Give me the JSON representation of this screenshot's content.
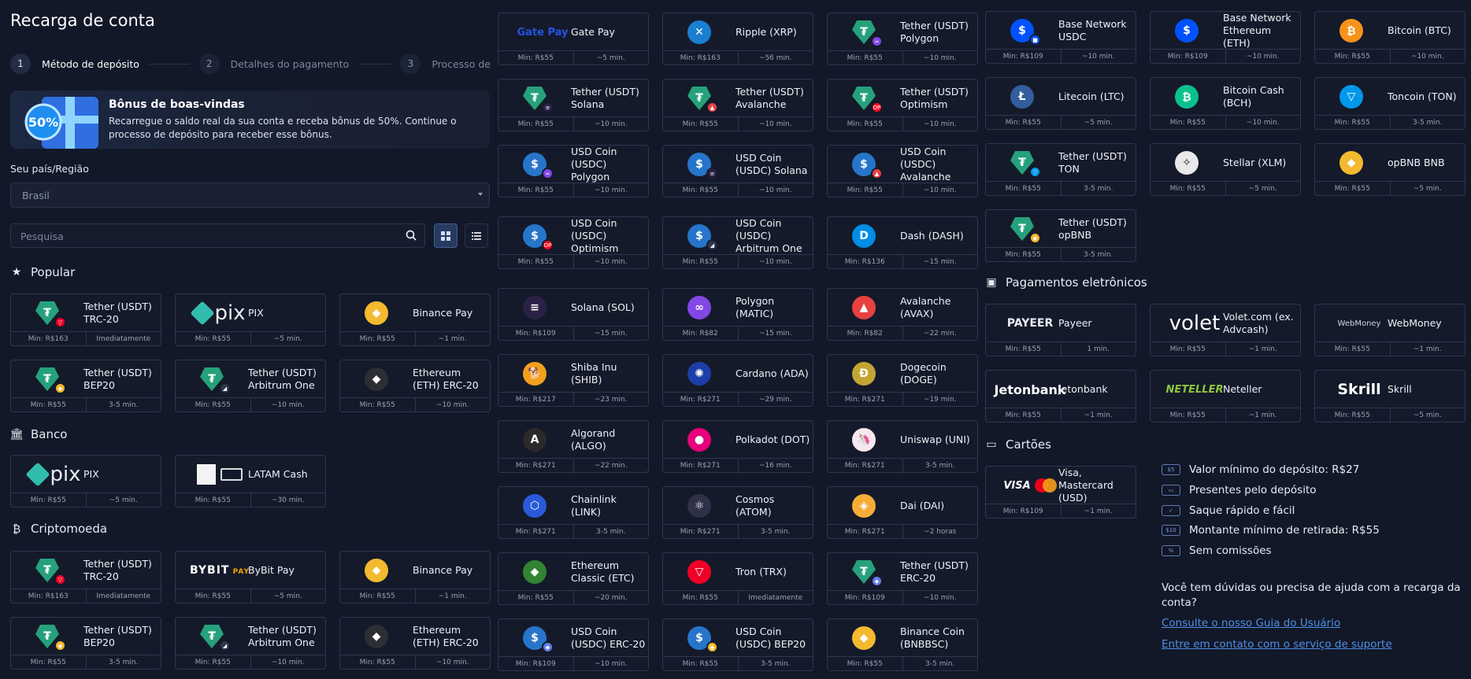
{
  "page": {
    "title": "Recarga de conta",
    "steps": [
      {
        "num": "1",
        "label": "Método de depósito"
      },
      {
        "num": "2",
        "label": "Detalhes do pagamento"
      },
      {
        "num": "3",
        "label": "Processo de"
      }
    ],
    "bonus": {
      "badge": "50%",
      "title": "Bônus de boas-vindas",
      "text": "Recarregue o saldo real da sua conta e receba bônus de 50%. Continue o processo de depósito para receber esse bônus."
    },
    "country_label": "Seu país/Região",
    "country_value": "Brasil",
    "search_placeholder": "Pesquisa",
    "sections": {
      "popular": "Popular",
      "bank": "Banco",
      "crypto": "Criptomoeda",
      "epay": "Pagamentos eletrônicos",
      "cards": "Cartões"
    }
  },
  "methods": {
    "popular": [
      {
        "name": "Tether (USDT) TRC-20",
        "min": "Min: R$163",
        "time": "Imediatamente",
        "icon": "tether-trc20-icon"
      },
      {
        "name": "PIX",
        "min": "Min: R$55",
        "time": "~5 min.",
        "icon": "pix-logo-icon",
        "logo_text": "pix"
      },
      {
        "name": "Binance Pay",
        "min": "Min: R$55",
        "time": "~1 min.",
        "icon": "binance-icon"
      },
      {
        "name": "Tether (USDT) BEP20",
        "min": "Min: R$55",
        "time": "3-5 min.",
        "icon": "tether-bep20-icon"
      },
      {
        "name": "Tether (USDT) Arbitrum One",
        "min": "Min: R$55",
        "time": "~10 min.",
        "icon": "tether-arbitrum-icon"
      },
      {
        "name": "Ethereum (ETH) ERC-20",
        "min": "Min: R$55",
        "time": "~10 min.",
        "icon": "ethereum-icon"
      }
    ],
    "bank": [
      {
        "name": "PIX",
        "min": "Min: R$55",
        "time": "~5 min.",
        "icon": "pix-logo-icon",
        "logo_text": "pix"
      },
      {
        "name": "LATAM Cash",
        "min": "Min: R$55",
        "time": "~30 min.",
        "icon": "latam-cash-icon"
      }
    ],
    "crypto_left": [
      {
        "name": "Tether (USDT) TRC-20",
        "min": "Min: R$163",
        "time": "Imediatamente",
        "icon": "tether-trc20-icon"
      },
      {
        "name": "ByBit Pay",
        "min": "Min: R$55",
        "time": "~5 min.",
        "icon": "bybit-logo-icon",
        "logo_text": "BYBIT"
      },
      {
        "name": "Binance Pay",
        "min": "Min: R$55",
        "time": "~1 min.",
        "icon": "binance-icon"
      },
      {
        "name": "Tether (USDT) BEP20",
        "min": "Min: R$55",
        "time": "3-5 min.",
        "icon": "tether-bep20-icon"
      },
      {
        "name": "Tether (USDT) Arbitrum One",
        "min": "Min: R$55",
        "time": "~10 min.",
        "icon": "tether-arbitrum-icon"
      },
      {
        "name": "Ethereum (ETH) ERC-20",
        "min": "Min: R$55",
        "time": "~10 min.",
        "icon": "ethereum-icon"
      }
    ],
    "crypto_mid": [
      {
        "name": "Gate Pay",
        "min": "Min: R$55",
        "time": "~5 min.",
        "icon": "gate-pay-logo-icon",
        "logo_text": "Gate Pay"
      },
      {
        "name": "Ripple (XRP)",
        "min": "Min: R$163",
        "time": "~56 min.",
        "icon": "xrp-icon"
      },
      {
        "name": "Tether (USDT) Polygon",
        "min": "Min: R$55",
        "time": "~10 min.",
        "icon": "tether-polygon-icon"
      },
      {
        "name": "Tether (USDT) Solana",
        "min": "Min: R$55",
        "time": "~10 min.",
        "icon": "tether-solana-icon"
      },
      {
        "name": "Tether (USDT) Avalanche",
        "min": "Min: R$55",
        "time": "~10 min.",
        "icon": "tether-avalanche-icon"
      },
      {
        "name": "Tether (USDT) Optimism",
        "min": "Min: R$55",
        "time": "~10 min.",
        "icon": "tether-optimism-icon"
      },
      {
        "name": "USD Coin (USDC) Polygon",
        "min": "Min: R$55",
        "time": "~10 min.",
        "icon": "usdc-polygon-icon"
      },
      {
        "name": "USD Coin (USDC) Solana",
        "min": "Min: R$55",
        "time": "~10 min.",
        "icon": "usdc-solana-icon"
      },
      {
        "name": "USD Coin (USDC) Avalanche",
        "min": "Min: R$55",
        "time": "~10 min.",
        "icon": "usdc-avalanche-icon"
      },
      {
        "name": "USD Coin (USDC) Optimism",
        "min": "Min: R$55",
        "time": "~10 min.",
        "icon": "usdc-optimism-icon"
      },
      {
        "name": "USD Coin (USDC) Arbitrum One",
        "min": "Min: R$55",
        "time": "~10 min.",
        "icon": "usdc-arbitrum-icon"
      },
      {
        "name": "Dash (DASH)",
        "min": "Min: R$136",
        "time": "~15 min.",
        "icon": "dash-icon"
      },
      {
        "name": "Solana (SOL)",
        "min": "Min: R$109",
        "time": "~15 min.",
        "icon": "solana-icon"
      },
      {
        "name": "Polygon (MATIC)",
        "min": "Min: R$82",
        "time": "~15 min.",
        "icon": "polygon-icon"
      },
      {
        "name": "Avalanche (AVAX)",
        "min": "Min: R$82",
        "time": "~22 min.",
        "icon": "avalanche-icon"
      },
      {
        "name": "Shiba Inu (SHIB)",
        "min": "Min: R$217",
        "time": "~23 min.",
        "icon": "shiba-icon"
      },
      {
        "name": "Cardano (ADA)",
        "min": "Min: R$271",
        "time": "~29 min.",
        "icon": "cardano-icon"
      },
      {
        "name": "Dogecoin (DOGE)",
        "min": "Min: R$271",
        "time": "~19 min.",
        "icon": "dogecoin-icon"
      },
      {
        "name": "Algorand (ALGO)",
        "min": "Min: R$271",
        "time": "~22 min.",
        "icon": "algorand-icon"
      },
      {
        "name": "Polkadot (DOT)",
        "min": "Min: R$271",
        "time": "~16 min.",
        "icon": "polkadot-icon"
      },
      {
        "name": "Uniswap (UNI)",
        "min": "Min: R$271",
        "time": "3-5 min.",
        "icon": "uniswap-icon"
      },
      {
        "name": "Chainlink (LINK)",
        "min": "Min: R$271",
        "time": "3-5 min.",
        "icon": "chainlink-icon"
      },
      {
        "name": "Cosmos (ATOM)",
        "min": "Min: R$271",
        "time": "3-5 min.",
        "icon": "cosmos-icon"
      },
      {
        "name": "Dai (DAI)",
        "min": "Min: R$271",
        "time": "~2 horas",
        "icon": "dai-icon"
      },
      {
        "name": "Ethereum Classic (ETC)",
        "min": "Min: R$55",
        "time": "~20 min.",
        "icon": "ethereum-classic-icon"
      },
      {
        "name": "Tron (TRX)",
        "min": "Min: R$55",
        "time": "Imediatamente",
        "icon": "tron-icon"
      },
      {
        "name": "Tether (USDT) ERC-20",
        "min": "Min: R$109",
        "time": "~10 min.",
        "icon": "tether-erc20-icon"
      },
      {
        "name": "USD Coin (USDC) ERC-20",
        "min": "Min: R$109",
        "time": "~10 min.",
        "icon": "usdc-erc20-icon"
      },
      {
        "name": "USD Coin (USDC) BEP20",
        "min": "Min: R$55",
        "time": "3-5 min.",
        "icon": "usdc-bep20-icon"
      },
      {
        "name": "Binance Coin (BNBBSC)",
        "min": "Min: R$55",
        "time": "3-5 min.",
        "icon": "bnb-icon"
      }
    ],
    "crypto_right": [
      {
        "name": "Base Network USDC",
        "min": "Min: R$109",
        "time": "~10 min.",
        "icon": "base-usdc-icon"
      },
      {
        "name": "Base Network Ethereum (ETH)",
        "min": "Min: R$109",
        "time": "~10 min.",
        "icon": "base-eth-icon"
      },
      {
        "name": "Bitcoin (BTC)",
        "min": "Min: R$55",
        "time": "~10 min.",
        "icon": "bitcoin-icon"
      },
      {
        "name": "Litecoin (LTC)",
        "min": "Min: R$55",
        "time": "~5 min.",
        "icon": "litecoin-icon"
      },
      {
        "name": "Bitcoin Cash (BCH)",
        "min": "Min: R$55",
        "time": "~10 min.",
        "icon": "bitcoin-cash-icon"
      },
      {
        "name": "Toncoin (TON)",
        "min": "Min: R$55",
        "time": "3-5 min.",
        "icon": "toncoin-icon"
      },
      {
        "name": "Tether (USDT) TON",
        "min": "Min: R$55",
        "time": "3-5 min.",
        "icon": "tether-ton-icon"
      },
      {
        "name": "Stellar (XLM)",
        "min": "Min: R$55",
        "time": "~5 min.",
        "icon": "stellar-icon"
      },
      {
        "name": "opBNB BNB",
        "min": "Min: R$55",
        "time": "~5 min.",
        "icon": "opbnb-icon"
      },
      {
        "name": "Tether (USDT) opBNB",
        "min": "Min: R$55",
        "time": "3-5 min.",
        "icon": "tether-opbnb-icon"
      }
    ],
    "epay": [
      {
        "name": "Payeer",
        "min": "Min: R$55",
        "time": "1 min.",
        "icon": "payeer-logo-icon",
        "logo_text": "PAYEER"
      },
      {
        "name": "Volet.com (ex. Advcash)",
        "min": "Min: R$55",
        "time": "~1 min.",
        "icon": "volet-logo-icon",
        "logo_text": "volet"
      },
      {
        "name": "WebMoney",
        "min": "Min: R$55",
        "time": "~1 min.",
        "icon": "webmoney-logo-icon",
        "logo_text": "WebMoney"
      },
      {
        "name": "Jetonbank",
        "min": "Min: R$55",
        "time": "~1 min.",
        "icon": "jetonbank-logo-icon",
        "logo_text": "Jetonbank"
      },
      {
        "name": "Neteller",
        "min": "Min: R$55",
        "time": "~1 min.",
        "icon": "neteller-logo-icon",
        "logo_text": "NETELLER"
      },
      {
        "name": "Skrill",
        "min": "Min: R$55",
        "time": "~5 min.",
        "icon": "skrill-logo-icon",
        "logo_text": "Skrill"
      }
    ],
    "cards": [
      {
        "name": "Visa, Mastercard (USD)",
        "min": "Min: R$109",
        "time": "~1 min.",
        "icon": "visa-mastercard-icon",
        "logo_text": "VISA"
      }
    ]
  },
  "features": [
    {
      "text": "Valor mínimo do depósito: R$27",
      "icon": "min-deposit-icon",
      "box": "$5"
    },
    {
      "text": "Presentes pelo depósito",
      "icon": "gift-card-icon",
      "box": "▭"
    },
    {
      "text": "Saque rápido e fácil",
      "icon": "check-icon",
      "box": "✓"
    },
    {
      "text": "Montante mínimo de retirada: R$55",
      "icon": "min-withdrawal-icon",
      "box": "$10"
    },
    {
      "text": "Sem comissões",
      "icon": "percent-icon",
      "box": "%"
    }
  ],
  "help": {
    "question": "Você tem dúvidas ou precisa de ajuda com a recarga da conta?",
    "guide_link": "Consulte o nosso Guia do Usuário",
    "support_link": "Entre em contato com o serviço de suporte"
  },
  "colors": {
    "background": "#121828",
    "card_border": "#2e3750",
    "link": "#4f8fe6",
    "accent": "#3f5fa0"
  }
}
